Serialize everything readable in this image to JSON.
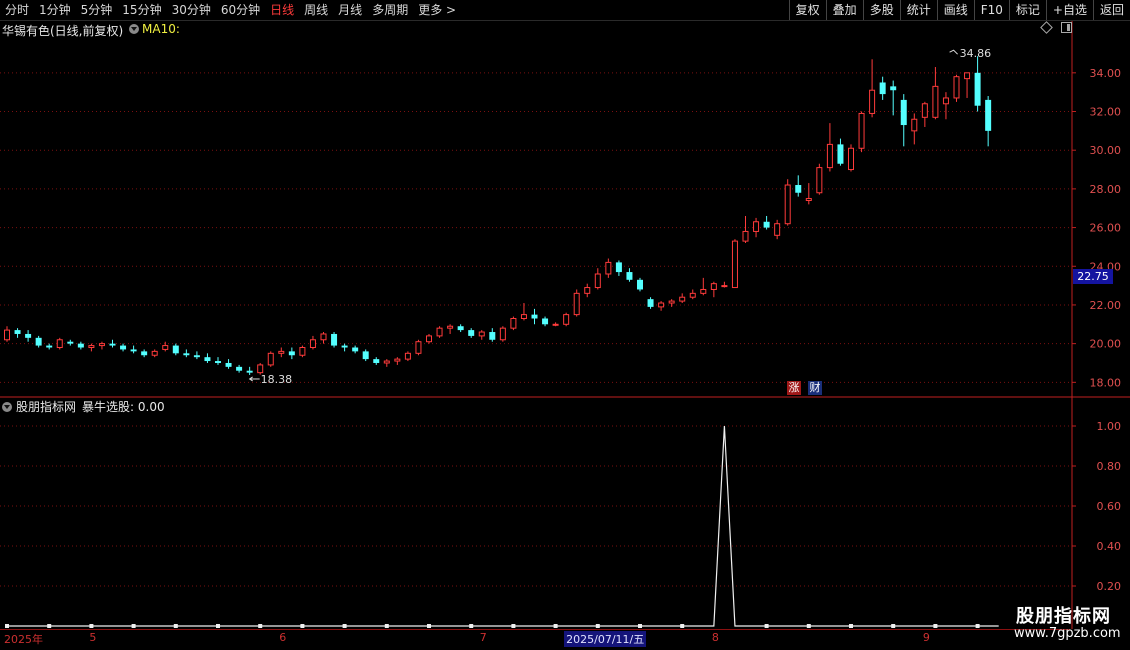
{
  "toolbar": {
    "periods": [
      "分时",
      "1分钟",
      "5分钟",
      "15分钟",
      "30分钟",
      "60分钟",
      "日线",
      "周线",
      "月线",
      "多周期",
      "更多 >"
    ],
    "active_period": "日线",
    "right_buttons": [
      "复权",
      "叠加",
      "多股",
      "统计",
      "画线",
      "F10",
      "标记",
      "+自选",
      "返回"
    ]
  },
  "stock": {
    "name": "华锡有色(日线,前复权)",
    "ma_label": "MA10:",
    "current_price_tag": "22.75",
    "high_label": "34.86",
    "low_label": "18.38"
  },
  "badges": {
    "zhang": "涨",
    "cai": "财"
  },
  "indicator": {
    "source": "股朋指标网",
    "name_value": "暴牛选股: 0.00"
  },
  "watermark": {
    "line1": "股朋指标网",
    "line2": "www.7gpzb.com"
  },
  "colors": {
    "up": "#ff3b3b",
    "down": "#54ffff",
    "grid": "#7a1010",
    "axis": "#c02020"
  },
  "chart_data": [
    {
      "type": "candlestick",
      "title": "华锡有色(日线,前复权)",
      "ylim": [
        17.5,
        35.8
      ],
      "yticks": [
        18,
        20,
        22,
        24,
        26,
        28,
        30,
        32,
        34
      ],
      "ytick_labels": [
        "18.00",
        "20.00",
        "22.00",
        "24.00",
        "26.00",
        "28.00",
        "30.00",
        "32.00",
        "34.00"
      ],
      "annotations": [
        {
          "text": "34.86",
          "value": 34.86
        },
        {
          "text": "18.38",
          "value": 18.38
        }
      ],
      "current_price": 22.75,
      "ohlc": [
        [
          20.2,
          20.9,
          20.1,
          20.7
        ],
        [
          20.7,
          20.8,
          20.3,
          20.5
        ],
        [
          20.5,
          20.7,
          20.1,
          20.3
        ],
        [
          20.3,
          20.4,
          19.8,
          19.9
        ],
        [
          19.9,
          20.0,
          19.7,
          19.8
        ],
        [
          19.8,
          20.3,
          19.7,
          20.2
        ],
        [
          20.1,
          20.2,
          19.9,
          20.0
        ],
        [
          20.0,
          20.1,
          19.7,
          19.8
        ],
        [
          19.8,
          20.0,
          19.6,
          19.9
        ],
        [
          19.9,
          20.1,
          19.7,
          20.0
        ],
        [
          20.0,
          20.2,
          19.8,
          19.9
        ],
        [
          19.9,
          20.0,
          19.6,
          19.7
        ],
        [
          19.7,
          19.9,
          19.5,
          19.6
        ],
        [
          19.6,
          19.7,
          19.3,
          19.4
        ],
        [
          19.4,
          19.7,
          19.3,
          19.6
        ],
        [
          19.7,
          20.1,
          19.6,
          19.9
        ],
        [
          19.9,
          20.0,
          19.4,
          19.5
        ],
        [
          19.5,
          19.7,
          19.3,
          19.4
        ],
        [
          19.4,
          19.6,
          19.2,
          19.3
        ],
        [
          19.3,
          19.5,
          19.0,
          19.1
        ],
        [
          19.1,
          19.3,
          18.9,
          19.0
        ],
        [
          19.0,
          19.2,
          18.7,
          18.8
        ],
        [
          18.8,
          18.9,
          18.5,
          18.6
        ],
        [
          18.6,
          18.8,
          18.38,
          18.5
        ],
        [
          18.5,
          19.0,
          18.4,
          18.9
        ],
        [
          18.9,
          19.6,
          18.8,
          19.5
        ],
        [
          19.5,
          19.8,
          19.3,
          19.6
        ],
        [
          19.6,
          19.8,
          19.2,
          19.4
        ],
        [
          19.4,
          19.9,
          19.3,
          19.8
        ],
        [
          19.8,
          20.4,
          19.7,
          20.2
        ],
        [
          20.2,
          20.6,
          20.0,
          20.5
        ],
        [
          20.5,
          20.6,
          19.8,
          19.9
        ],
        [
          19.9,
          20.0,
          19.6,
          19.8
        ],
        [
          19.8,
          19.9,
          19.5,
          19.6
        ],
        [
          19.6,
          19.7,
          19.1,
          19.2
        ],
        [
          19.2,
          19.3,
          18.9,
          19.0
        ],
        [
          19.0,
          19.2,
          18.8,
          19.1
        ],
        [
          19.1,
          19.3,
          18.9,
          19.2
        ],
        [
          19.2,
          19.6,
          19.1,
          19.5
        ],
        [
          19.5,
          20.2,
          19.4,
          20.1
        ],
        [
          20.1,
          20.5,
          20.0,
          20.4
        ],
        [
          20.4,
          20.9,
          20.3,
          20.8
        ],
        [
          20.8,
          21.0,
          20.5,
          20.9
        ],
        [
          20.9,
          21.0,
          20.6,
          20.7
        ],
        [
          20.7,
          20.8,
          20.3,
          20.4
        ],
        [
          20.4,
          20.7,
          20.2,
          20.6
        ],
        [
          20.6,
          20.8,
          20.1,
          20.2
        ],
        [
          20.2,
          20.9,
          20.1,
          20.8
        ],
        [
          20.8,
          21.4,
          20.7,
          21.3
        ],
        [
          21.3,
          22.1,
          21.2,
          21.5
        ],
        [
          21.5,
          21.8,
          21.0,
          21.3
        ],
        [
          21.3,
          21.4,
          20.9,
          21.0
        ],
        [
          21.0,
          21.1,
          20.9,
          21.0
        ],
        [
          21.0,
          21.6,
          20.9,
          21.5
        ],
        [
          21.5,
          22.8,
          21.4,
          22.6
        ],
        [
          22.6,
          23.1,
          22.4,
          22.9
        ],
        [
          22.9,
          23.9,
          22.8,
          23.6
        ],
        [
          23.6,
          24.4,
          23.4,
          24.2
        ],
        [
          24.2,
          24.3,
          23.5,
          23.7
        ],
        [
          23.7,
          23.9,
          23.2,
          23.3
        ],
        [
          23.3,
          23.4,
          22.7,
          22.8
        ],
        [
          22.3,
          22.4,
          21.8,
          21.9
        ],
        [
          21.9,
          22.2,
          21.7,
          22.1
        ],
        [
          22.1,
          22.3,
          21.9,
          22.2
        ],
        [
          22.2,
          22.6,
          22.1,
          22.4
        ],
        [
          22.4,
          22.8,
          22.3,
          22.6
        ],
        [
          22.6,
          23.4,
          22.5,
          22.8
        ],
        [
          22.8,
          23.2,
          22.4,
          23.1
        ],
        [
          23.0,
          23.2,
          22.9,
          23.0
        ],
        [
          22.9,
          25.4,
          22.9,
          25.3
        ],
        [
          25.3,
          26.6,
          25.2,
          25.8
        ],
        [
          25.8,
          26.5,
          25.5,
          26.3
        ],
        [
          26.3,
          26.6,
          25.9,
          26.0
        ],
        [
          25.6,
          26.4,
          25.4,
          26.2
        ],
        [
          26.2,
          28.5,
          26.1,
          28.2
        ],
        [
          28.2,
          28.7,
          27.6,
          27.8
        ],
        [
          27.4,
          28.3,
          27.2,
          27.5
        ],
        [
          27.8,
          29.3,
          27.7,
          29.1
        ],
        [
          29.1,
          31.4,
          28.9,
          30.3
        ],
        [
          30.3,
          30.6,
          29.2,
          29.3
        ],
        [
          29.0,
          30.3,
          28.9,
          30.1
        ],
        [
          30.1,
          32.0,
          29.9,
          31.9
        ],
        [
          31.9,
          34.7,
          31.7,
          33.1
        ],
        [
          33.5,
          33.8,
          32.6,
          32.9
        ],
        [
          33.3,
          33.6,
          31.8,
          33.1
        ],
        [
          32.6,
          32.9,
          30.2,
          31.3
        ],
        [
          31.0,
          31.9,
          30.3,
          31.6
        ],
        [
          31.7,
          32.5,
          31.2,
          32.4
        ],
        [
          31.7,
          34.3,
          31.6,
          33.3
        ],
        [
          32.4,
          33.0,
          31.6,
          32.7
        ],
        [
          32.7,
          33.9,
          32.5,
          33.8
        ],
        [
          33.7,
          34.0,
          32.7,
          34.0
        ],
        [
          34.0,
          34.86,
          32.0,
          32.3
        ],
        [
          32.6,
          32.8,
          30.2,
          31.0
        ]
      ]
    },
    {
      "type": "line",
      "title": "暴牛选股",
      "ylim": [
        0,
        1.05
      ],
      "yticks": [
        0.2,
        0.4,
        0.6,
        0.8,
        1.0
      ],
      "ytick_labels": [
        "0.20",
        "0.40",
        "0.60",
        "0.80",
        "1.00"
      ],
      "series": [
        {
          "name": "暴牛选股",
          "values": [
            0,
            0,
            0,
            0,
            0,
            0,
            0,
            0,
            0,
            0,
            0,
            0,
            0,
            0,
            0,
            0,
            0,
            0,
            0,
            0,
            0,
            0,
            0,
            0,
            0,
            0,
            0,
            0,
            0,
            0,
            0,
            0,
            0,
            0,
            0,
            0,
            0,
            0,
            0,
            0,
            0,
            0,
            0,
            0,
            0,
            0,
            0,
            0,
            0,
            0,
            0,
            0,
            0,
            0,
            0,
            0,
            0,
            0,
            0,
            0,
            0,
            0,
            0,
            0,
            0,
            0,
            0,
            0,
            1,
            0,
            0,
            0,
            0,
            0,
            0,
            0,
            0,
            0,
            0,
            0,
            0,
            0,
            0,
            0,
            0,
            0,
            0,
            0,
            0,
            0,
            0,
            0,
            0,
            0,
            0
          ]
        }
      ],
      "x_labels": [
        "2025年",
        "5",
        "6",
        "7",
        "2025/07/11/五",
        "8",
        "9"
      ],
      "x_label_days": [
        0,
        8,
        26,
        45,
        53,
        67,
        87
      ],
      "selected_label": "2025/07/11/五"
    }
  ]
}
